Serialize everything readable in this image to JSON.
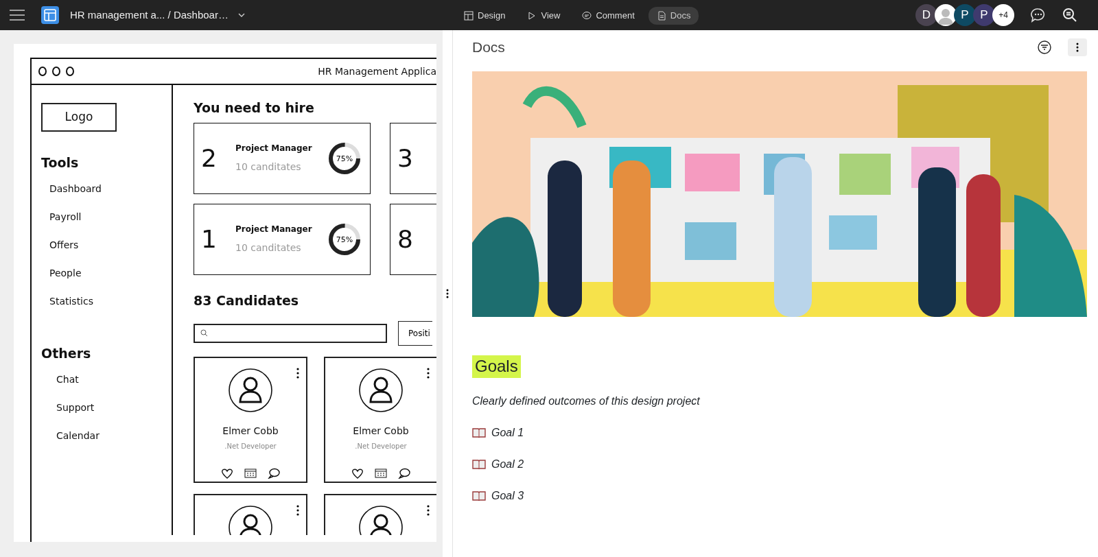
{
  "topbar": {
    "title": "HR management a... / Dashboar…",
    "tabs": [
      {
        "label": "Design",
        "kind": "layout",
        "selected": false
      },
      {
        "label": "View",
        "kind": "play",
        "selected": false
      },
      {
        "label": "Comment",
        "kind": "comment",
        "selected": false
      },
      {
        "label": "Docs",
        "kind": "doc",
        "selected": true
      }
    ],
    "avatars": [
      {
        "kind": "letter",
        "label": "D",
        "color": "#4a4350"
      },
      {
        "kind": "photo",
        "color": "#ffffff"
      },
      {
        "kind": "letter",
        "label": "P",
        "color": "#0e4a63"
      },
      {
        "kind": "letter",
        "label": "P",
        "color": "#3f3a6e"
      },
      {
        "kind": "count",
        "label": "+4",
        "color": "#ffffff"
      }
    ]
  },
  "wireframe": {
    "window_title": "HR Management Applica",
    "logo": "Logo",
    "sections": [
      {
        "heading": "Tools",
        "items": [
          "Dashboard",
          "Payroll",
          "Offers",
          "People",
          "Statistics"
        ]
      },
      {
        "heading": "Others",
        "items": [
          "Chat",
          "Support",
          "Calendar"
        ]
      }
    ],
    "hire_heading": "You need to hire",
    "hire_cards": [
      {
        "count": "2",
        "position": "Project Manager",
        "candidates": "10 canditates",
        "level": 0.75,
        "reading": "75%"
      },
      {
        "count": "3"
      },
      {
        "count": "1",
        "position": "Project Manager",
        "candidates": "10 canditates",
        "level": 0.75,
        "reading": "75%"
      },
      {
        "count": "8"
      }
    ],
    "candidates_heading": "83 Candidates",
    "position_button": "Positi",
    "candidate_cards": [
      {
        "name": "Elmer Cobb",
        "role": ".Net Developer",
        "clipped": false
      },
      {
        "name": "Elmer Cobb",
        "role": ".Net Developer",
        "clipped": false
      },
      {
        "clipped": true
      },
      {
        "clipped": true
      }
    ]
  },
  "docs": {
    "title": "Docs",
    "heading": "Goals",
    "description": "Clearly defined outcomes of this design project",
    "goals": [
      "Goal 1",
      "Goal 2",
      "Goal 3"
    ]
  }
}
